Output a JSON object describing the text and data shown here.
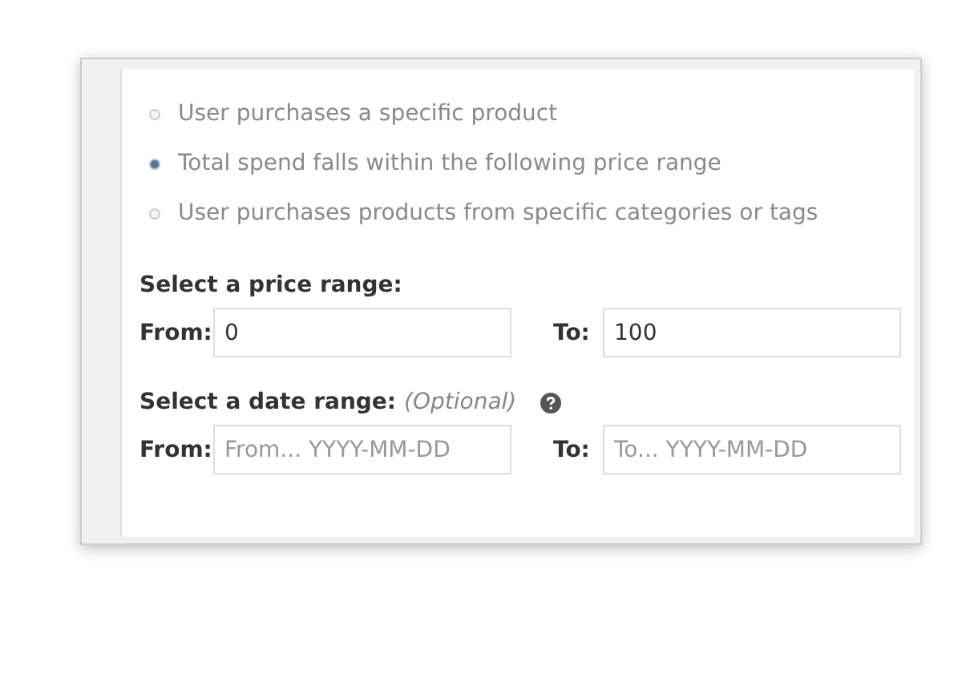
{
  "options": [
    {
      "label": "User purchases a specific product",
      "selected": false
    },
    {
      "label": "Total spend falls within the following price range",
      "selected": true
    },
    {
      "label": "User purchases products from specific categories or tags",
      "selected": false
    }
  ],
  "price_range": {
    "heading": "Select a price range:",
    "from_label": "From:",
    "from_value": "0",
    "to_label": "To:",
    "to_value": "100"
  },
  "date_range": {
    "heading": "Select a date range:",
    "note": "(Optional)",
    "from_label": "From:",
    "from_placeholder": "From... YYYY-MM-DD",
    "to_label": "To:",
    "to_placeholder": "To... YYYY-MM-DD"
  }
}
